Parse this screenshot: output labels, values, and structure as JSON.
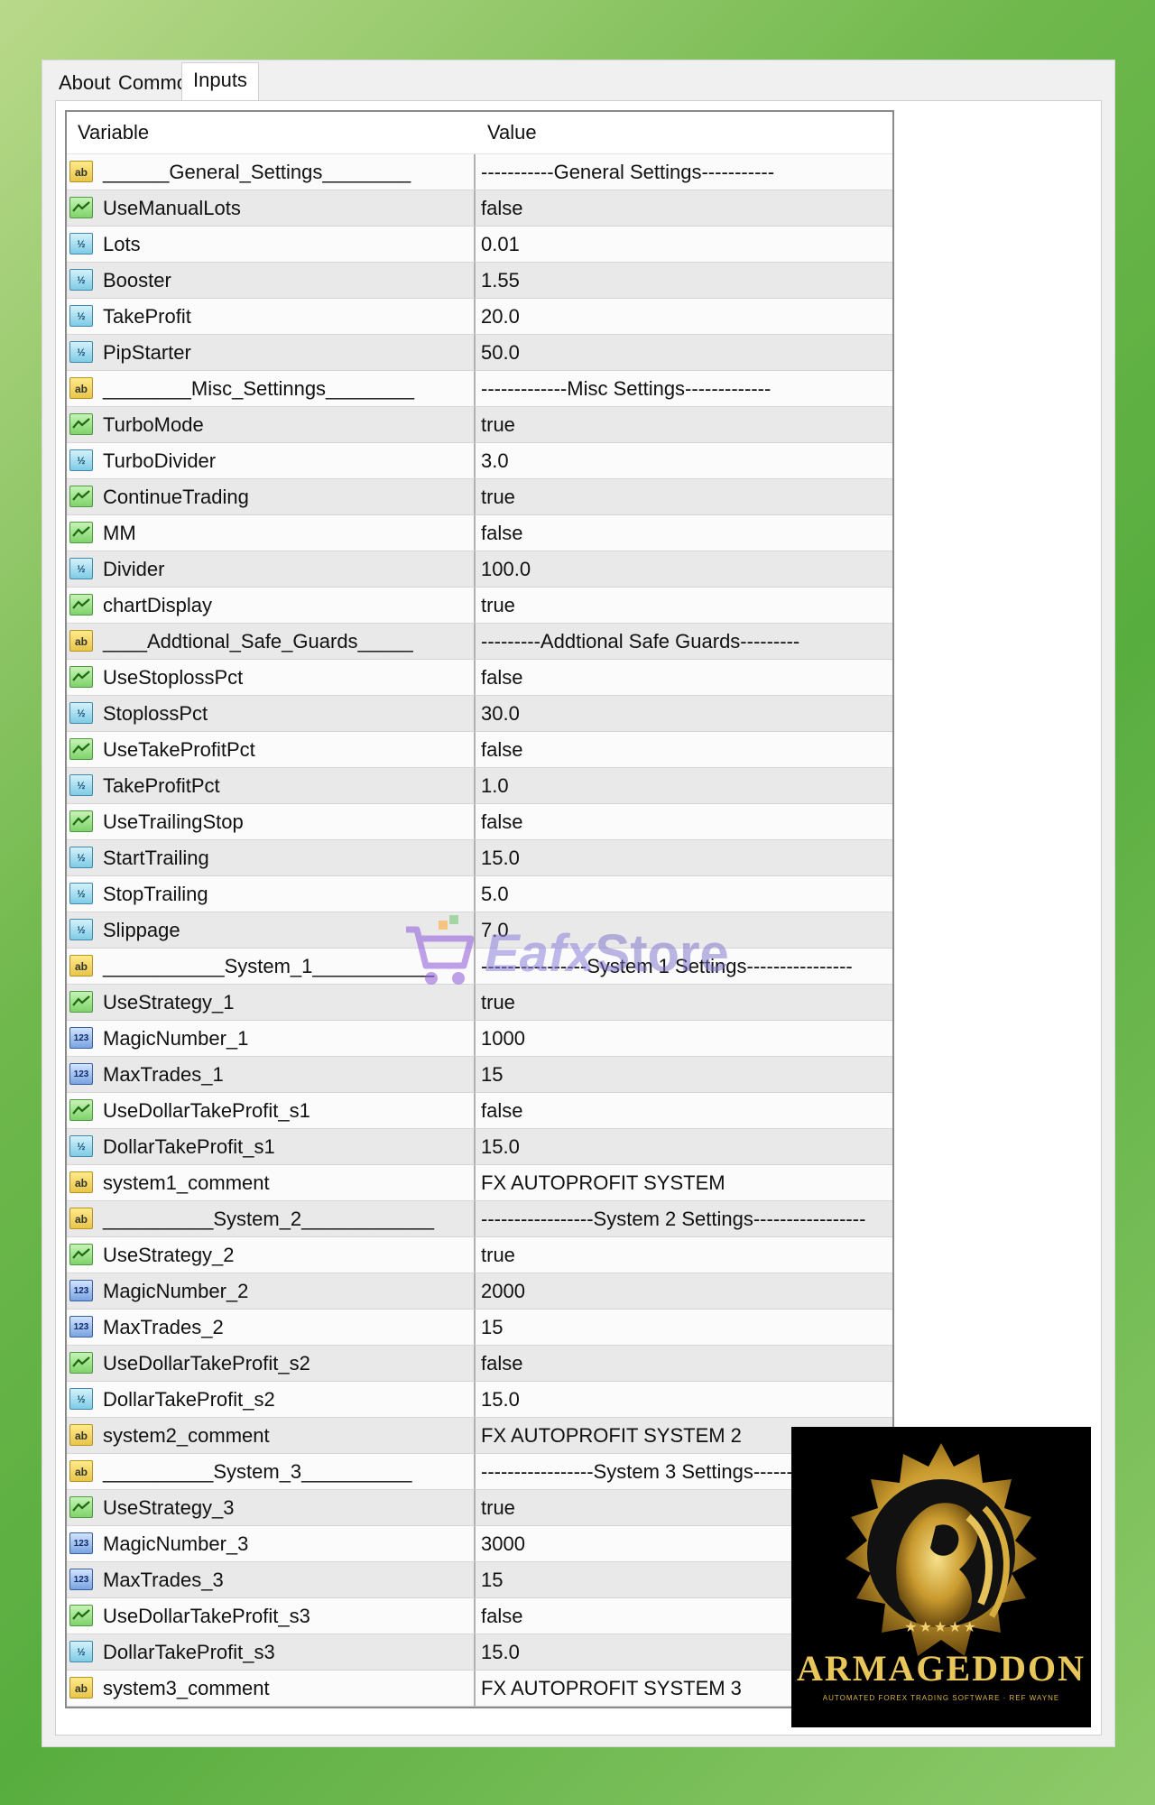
{
  "tabs": [
    {
      "label": "About"
    },
    {
      "label": "Common"
    },
    {
      "label": "Inputs"
    }
  ],
  "columns": {
    "variable": "Variable",
    "value": "Value"
  },
  "rows": [
    {
      "type": "string",
      "icon": "ab",
      "name": "______General_Settings________",
      "value": "-----------General Settings-----------"
    },
    {
      "type": "bool",
      "icon": "bool-icon",
      "name": "UseManualLots",
      "value": "false"
    },
    {
      "type": "double",
      "icon": "½",
      "name": "Lots",
      "value": "0.01"
    },
    {
      "type": "double",
      "icon": "½",
      "name": "Booster",
      "value": "1.55"
    },
    {
      "type": "double",
      "icon": "½",
      "name": "TakeProfit",
      "value": "20.0"
    },
    {
      "type": "double",
      "icon": "½",
      "name": "PipStarter",
      "value": "50.0"
    },
    {
      "type": "string",
      "icon": "ab",
      "name": "________Misc_Settinngs________",
      "value": "-------------Misc Settings-------------"
    },
    {
      "type": "bool",
      "icon": "bool-icon",
      "name": "TurboMode",
      "value": "true"
    },
    {
      "type": "double",
      "icon": "½",
      "name": "TurboDivider",
      "value": "3.0"
    },
    {
      "type": "bool",
      "icon": "bool-icon",
      "name": "ContinueTrading",
      "value": "true"
    },
    {
      "type": "bool",
      "icon": "bool-icon",
      "name": "MM",
      "value": "false"
    },
    {
      "type": "double",
      "icon": "½",
      "name": "Divider",
      "value": "100.0"
    },
    {
      "type": "bool",
      "icon": "bool-icon",
      "name": "chartDisplay",
      "value": "true"
    },
    {
      "type": "string",
      "icon": "ab",
      "name": "____Addtional_Safe_Guards_____",
      "value": "---------Addtional Safe Guards---------"
    },
    {
      "type": "bool",
      "icon": "bool-icon",
      "name": "UseStoplossPct",
      "value": "false"
    },
    {
      "type": "double",
      "icon": "½",
      "name": "StoplossPct",
      "value": "30.0"
    },
    {
      "type": "bool",
      "icon": "bool-icon",
      "name": "UseTakeProfitPct",
      "value": "false"
    },
    {
      "type": "double",
      "icon": "½",
      "name": "TakeProfitPct",
      "value": "1.0"
    },
    {
      "type": "bool",
      "icon": "bool-icon",
      "name": "UseTrailingStop",
      "value": "false"
    },
    {
      "type": "double",
      "icon": "½",
      "name": "StartTrailing",
      "value": "15.0"
    },
    {
      "type": "double",
      "icon": "½",
      "name": "StopTrailing",
      "value": "5.0"
    },
    {
      "type": "double",
      "icon": "½",
      "name": "Slippage",
      "value": "7.0"
    },
    {
      "type": "string",
      "icon": "ab",
      "name": "___________System_1___________",
      "value": "----------------System 1 Settings----------------"
    },
    {
      "type": "bool",
      "icon": "bool-icon",
      "name": "UseStrategy_1",
      "value": "true"
    },
    {
      "type": "int",
      "icon": "123",
      "name": "MagicNumber_1",
      "value": "1000"
    },
    {
      "type": "int",
      "icon": "123",
      "name": "MaxTrades_1",
      "value": "15"
    },
    {
      "type": "bool",
      "icon": "bool-icon",
      "name": "UseDollarTakeProfit_s1",
      "value": "false"
    },
    {
      "type": "double",
      "icon": "½",
      "name": "DollarTakeProfit_s1",
      "value": "15.0"
    },
    {
      "type": "string",
      "icon": "ab",
      "name": "system1_comment",
      "value": "FX AUTOPROFIT SYSTEM"
    },
    {
      "type": "string",
      "icon": "ab",
      "name": "__________System_2____________",
      "value": "-----------------System 2 Settings-----------------"
    },
    {
      "type": "bool",
      "icon": "bool-icon",
      "name": "UseStrategy_2",
      "value": "true"
    },
    {
      "type": "int",
      "icon": "123",
      "name": "MagicNumber_2",
      "value": "2000"
    },
    {
      "type": "int",
      "icon": "123",
      "name": "MaxTrades_2",
      "value": "15"
    },
    {
      "type": "bool",
      "icon": "bool-icon",
      "name": "UseDollarTakeProfit_s2",
      "value": "false"
    },
    {
      "type": "double",
      "icon": "½",
      "name": "DollarTakeProfit_s2",
      "value": "15.0"
    },
    {
      "type": "string",
      "icon": "ab",
      "name": "system2_comment",
      "value": "FX AUTOPROFIT SYSTEM 2"
    },
    {
      "type": "string",
      "icon": "ab",
      "name": "__________System_3__________",
      "value": "-----------------System 3 Settings-----------------"
    },
    {
      "type": "bool",
      "icon": "bool-icon",
      "name": "UseStrategy_3",
      "value": "true"
    },
    {
      "type": "int",
      "icon": "123",
      "name": "MagicNumber_3",
      "value": "3000"
    },
    {
      "type": "int",
      "icon": "123",
      "name": "MaxTrades_3",
      "value": "15"
    },
    {
      "type": "bool",
      "icon": "bool-icon",
      "name": "UseDollarTakeProfit_s3",
      "value": "false"
    },
    {
      "type": "double",
      "icon": "½",
      "name": "DollarTakeProfit_s3",
      "value": "15.0"
    },
    {
      "type": "string",
      "icon": "ab",
      "name": "system3_comment",
      "value": "FX AUTOPROFIT SYSTEM 3"
    }
  ],
  "watermark": {
    "brand": "Eafx",
    "suffix": "Store"
  },
  "logo": {
    "title": "ARMAGEDDON",
    "tagline": "AUTOMATED FOREX TRADING SOFTWARE · REF WAYNE",
    "stars": "★★★★★"
  },
  "colors": {
    "gold": "#d9b24a",
    "green_bg": "#58ad3f"
  }
}
